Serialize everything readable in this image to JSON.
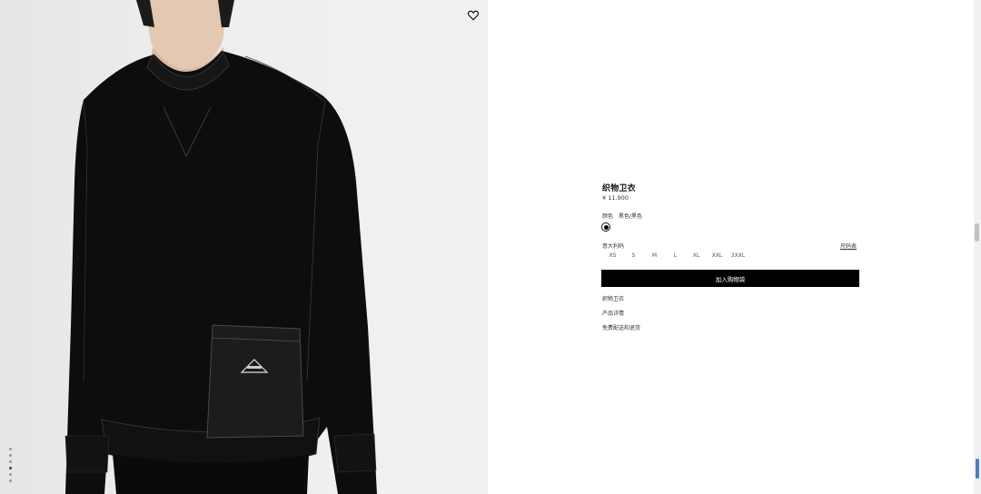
{
  "gallery": {
    "image_alt": "",
    "slide_count": 6,
    "active_slide": 4,
    "wishlist_icon": "heart-icon"
  },
  "product": {
    "name": "织物卫衣",
    "price": "¥ 11,900",
    "color_label": "颜色",
    "color_value": "黑色/黑色",
    "selected_color_hex": "#000000",
    "size_label": "意大利码",
    "size_guide": "尺码表",
    "sizes": [
      "XS",
      "S",
      "M",
      "L",
      "XL",
      "XXL",
      "3XXL"
    ]
  },
  "actions": {
    "add_to_cart": "加入购物袋"
  },
  "links": [
    "织物卫衣",
    "产品详情",
    "免费配送和退货"
  ]
}
